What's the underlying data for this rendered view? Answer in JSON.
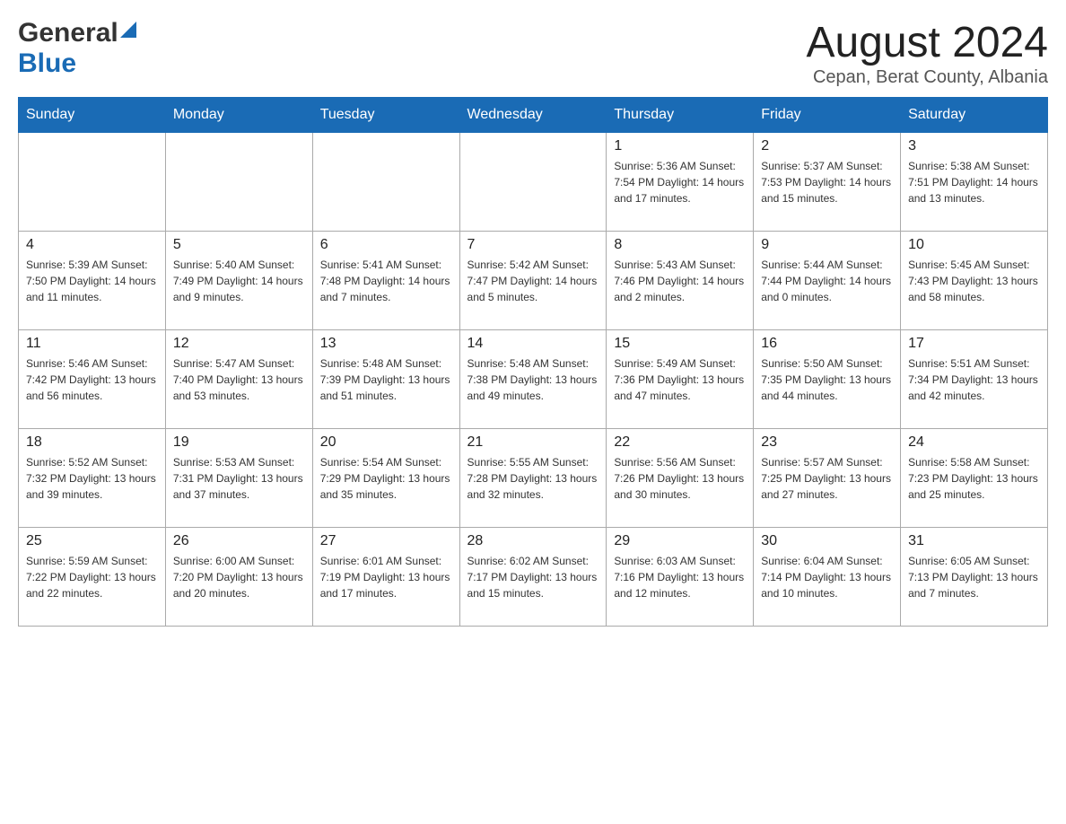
{
  "header": {
    "title": "August 2024",
    "subtitle": "Cepan, Berat County, Albania"
  },
  "logo": {
    "general": "General",
    "blue": "Blue"
  },
  "days": [
    "Sunday",
    "Monday",
    "Tuesday",
    "Wednesday",
    "Thursday",
    "Friday",
    "Saturday"
  ],
  "weeks": [
    {
      "cells": [
        {
          "day": "",
          "info": ""
        },
        {
          "day": "",
          "info": ""
        },
        {
          "day": "",
          "info": ""
        },
        {
          "day": "",
          "info": ""
        },
        {
          "day": "1",
          "info": "Sunrise: 5:36 AM\nSunset: 7:54 PM\nDaylight: 14 hours and 17 minutes."
        },
        {
          "day": "2",
          "info": "Sunrise: 5:37 AM\nSunset: 7:53 PM\nDaylight: 14 hours and 15 minutes."
        },
        {
          "day": "3",
          "info": "Sunrise: 5:38 AM\nSunset: 7:51 PM\nDaylight: 14 hours and 13 minutes."
        }
      ]
    },
    {
      "cells": [
        {
          "day": "4",
          "info": "Sunrise: 5:39 AM\nSunset: 7:50 PM\nDaylight: 14 hours and 11 minutes."
        },
        {
          "day": "5",
          "info": "Sunrise: 5:40 AM\nSunset: 7:49 PM\nDaylight: 14 hours and 9 minutes."
        },
        {
          "day": "6",
          "info": "Sunrise: 5:41 AM\nSunset: 7:48 PM\nDaylight: 14 hours and 7 minutes."
        },
        {
          "day": "7",
          "info": "Sunrise: 5:42 AM\nSunset: 7:47 PM\nDaylight: 14 hours and 5 minutes."
        },
        {
          "day": "8",
          "info": "Sunrise: 5:43 AM\nSunset: 7:46 PM\nDaylight: 14 hours and 2 minutes."
        },
        {
          "day": "9",
          "info": "Sunrise: 5:44 AM\nSunset: 7:44 PM\nDaylight: 14 hours and 0 minutes."
        },
        {
          "day": "10",
          "info": "Sunrise: 5:45 AM\nSunset: 7:43 PM\nDaylight: 13 hours and 58 minutes."
        }
      ]
    },
    {
      "cells": [
        {
          "day": "11",
          "info": "Sunrise: 5:46 AM\nSunset: 7:42 PM\nDaylight: 13 hours and 56 minutes."
        },
        {
          "day": "12",
          "info": "Sunrise: 5:47 AM\nSunset: 7:40 PM\nDaylight: 13 hours and 53 minutes."
        },
        {
          "day": "13",
          "info": "Sunrise: 5:48 AM\nSunset: 7:39 PM\nDaylight: 13 hours and 51 minutes."
        },
        {
          "day": "14",
          "info": "Sunrise: 5:48 AM\nSunset: 7:38 PM\nDaylight: 13 hours and 49 minutes."
        },
        {
          "day": "15",
          "info": "Sunrise: 5:49 AM\nSunset: 7:36 PM\nDaylight: 13 hours and 47 minutes."
        },
        {
          "day": "16",
          "info": "Sunrise: 5:50 AM\nSunset: 7:35 PM\nDaylight: 13 hours and 44 minutes."
        },
        {
          "day": "17",
          "info": "Sunrise: 5:51 AM\nSunset: 7:34 PM\nDaylight: 13 hours and 42 minutes."
        }
      ]
    },
    {
      "cells": [
        {
          "day": "18",
          "info": "Sunrise: 5:52 AM\nSunset: 7:32 PM\nDaylight: 13 hours and 39 minutes."
        },
        {
          "day": "19",
          "info": "Sunrise: 5:53 AM\nSunset: 7:31 PM\nDaylight: 13 hours and 37 minutes."
        },
        {
          "day": "20",
          "info": "Sunrise: 5:54 AM\nSunset: 7:29 PM\nDaylight: 13 hours and 35 minutes."
        },
        {
          "day": "21",
          "info": "Sunrise: 5:55 AM\nSunset: 7:28 PM\nDaylight: 13 hours and 32 minutes."
        },
        {
          "day": "22",
          "info": "Sunrise: 5:56 AM\nSunset: 7:26 PM\nDaylight: 13 hours and 30 minutes."
        },
        {
          "day": "23",
          "info": "Sunrise: 5:57 AM\nSunset: 7:25 PM\nDaylight: 13 hours and 27 minutes."
        },
        {
          "day": "24",
          "info": "Sunrise: 5:58 AM\nSunset: 7:23 PM\nDaylight: 13 hours and 25 minutes."
        }
      ]
    },
    {
      "cells": [
        {
          "day": "25",
          "info": "Sunrise: 5:59 AM\nSunset: 7:22 PM\nDaylight: 13 hours and 22 minutes."
        },
        {
          "day": "26",
          "info": "Sunrise: 6:00 AM\nSunset: 7:20 PM\nDaylight: 13 hours and 20 minutes."
        },
        {
          "day": "27",
          "info": "Sunrise: 6:01 AM\nSunset: 7:19 PM\nDaylight: 13 hours and 17 minutes."
        },
        {
          "day": "28",
          "info": "Sunrise: 6:02 AM\nSunset: 7:17 PM\nDaylight: 13 hours and 15 minutes."
        },
        {
          "day": "29",
          "info": "Sunrise: 6:03 AM\nSunset: 7:16 PM\nDaylight: 13 hours and 12 minutes."
        },
        {
          "day": "30",
          "info": "Sunrise: 6:04 AM\nSunset: 7:14 PM\nDaylight: 13 hours and 10 minutes."
        },
        {
          "day": "31",
          "info": "Sunrise: 6:05 AM\nSunset: 7:13 PM\nDaylight: 13 hours and 7 minutes."
        }
      ]
    }
  ]
}
